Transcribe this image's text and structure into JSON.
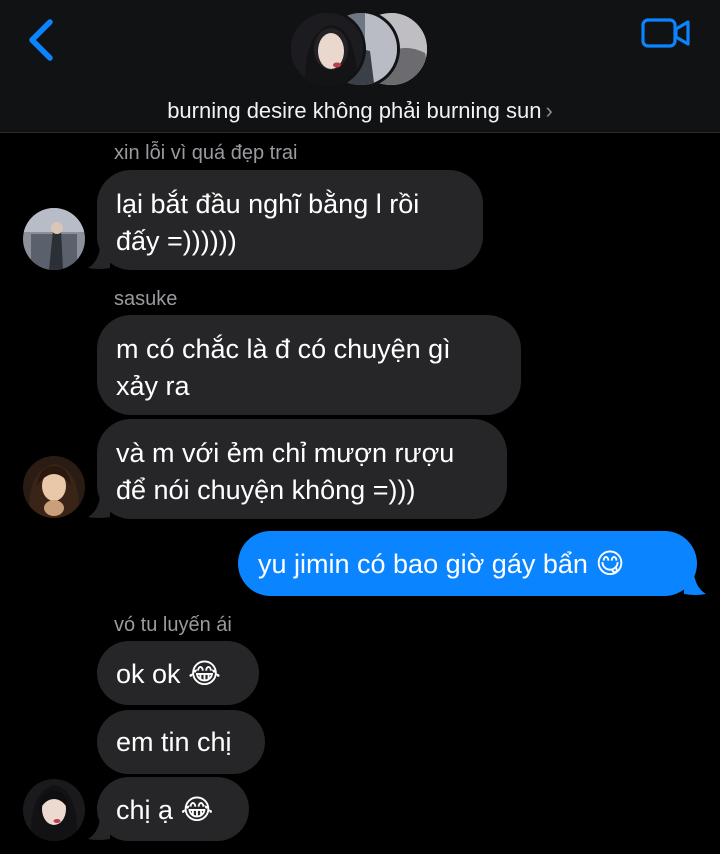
{
  "header": {
    "title": "burning desire không phải burning sun",
    "chevron": "›",
    "back_icon": "chevron-left-icon",
    "video_icon": "video-camera-icon",
    "accent_color": "#0a84ff"
  },
  "messages": [
    {
      "sender": "xin lỗi vì quá đẹp trai",
      "lines": [
        "lại bắt đầu nghĩ bằng l rồi",
        "đấy =))))))"
      ]
    },
    {
      "sender": "sasuke",
      "lines": [
        "m có chắc là đ có chuyện gì",
        "xảy ra"
      ]
    },
    {
      "lines": [
        "và m với ẻm chỉ mượn rượu",
        "để nói chuyện không =)))"
      ]
    },
    {
      "outgoing": true,
      "text": "yu jimin có bao giờ gáy bẩn",
      "emoji": "😋"
    },
    {
      "sender": "vó tu luyến ái",
      "text": "ok ok",
      "emoji": "😂"
    },
    {
      "text": "em tin chị"
    },
    {
      "text": "chị ạ",
      "emoji": "😂"
    }
  ],
  "colors": {
    "incoming_bubble": "#262628",
    "outgoing_bubble": "#0a84ff",
    "sender_text": "#9a9a9f"
  }
}
